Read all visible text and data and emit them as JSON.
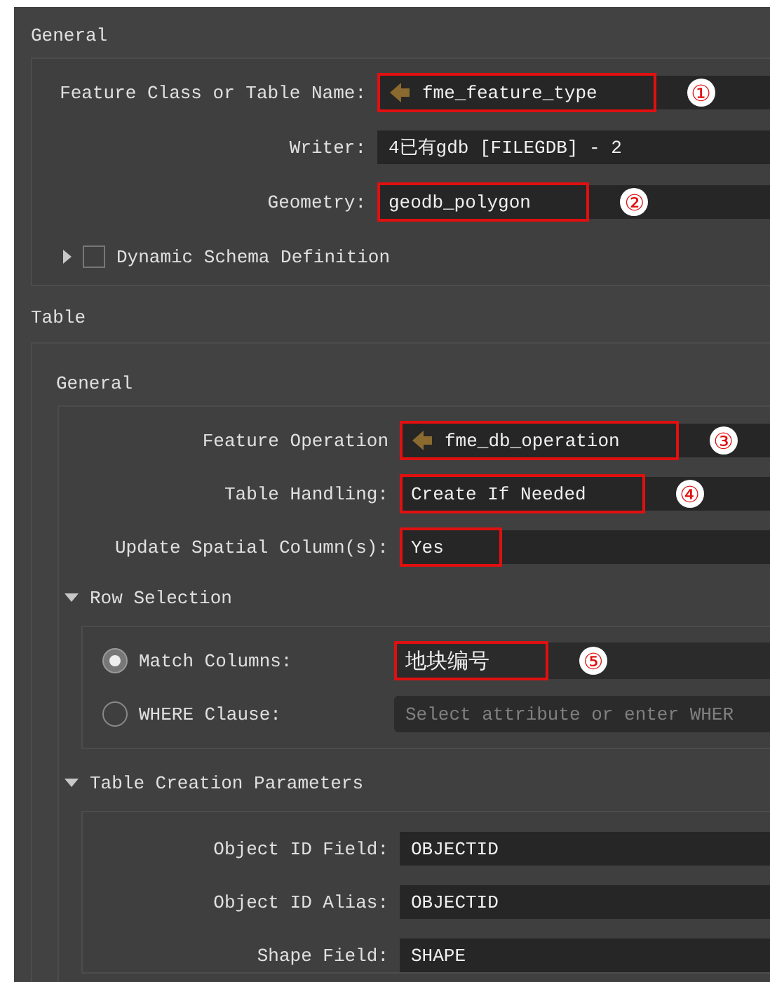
{
  "general": {
    "title": "General",
    "fields": [
      {
        "label": "Feature Class or Table Name:",
        "value": "fme_feature_type",
        "attribute": true,
        "highlighted": true,
        "marker": "①"
      },
      {
        "label": "Writer:",
        "value": "4已有gdb [FILEGDB] - 2",
        "attribute": false,
        "highlighted": false
      },
      {
        "label": "Geometry:",
        "value": "geodb_polygon",
        "attribute": false,
        "highlighted": true,
        "marker": "②"
      }
    ],
    "dynamic_schema": {
      "label": "Dynamic Schema Definition",
      "checked": false,
      "expanded": false
    }
  },
  "table": {
    "title": "Table",
    "general": {
      "title": "General",
      "fields": [
        {
          "label": "Feature Operation",
          "value": "fme_db_operation",
          "attribute": true,
          "highlighted": true,
          "marker": "③"
        },
        {
          "label": "Table Handling:",
          "value": "Create If Needed",
          "attribute": false,
          "highlighted": true,
          "marker": "④"
        },
        {
          "label": "Update Spatial Column(s):",
          "value": "Yes",
          "attribute": false,
          "highlighted": true
        }
      ]
    },
    "row_selection": {
      "title": "Row Selection",
      "expanded": true,
      "options": [
        {
          "label": "Match Columns:",
          "selected": true,
          "value": "地块编号",
          "highlighted": true,
          "marker": "⑤"
        },
        {
          "label": "WHERE Clause:",
          "selected": false,
          "placeholder": "Select attribute or enter WHER",
          "highlighted": false
        }
      ]
    },
    "creation": {
      "title": "Table Creation Parameters",
      "expanded": true,
      "fields": [
        {
          "label": "Object ID Field:",
          "value": "OBJECTID",
          "attribute": false,
          "highlighted": false
        },
        {
          "label": "Object ID Alias:",
          "value": "OBJECTID",
          "attribute": false,
          "highlighted": false
        },
        {
          "label": "Shape Field:",
          "value": "SHAPE",
          "attribute": false,
          "highlighted": false
        }
      ]
    }
  }
}
